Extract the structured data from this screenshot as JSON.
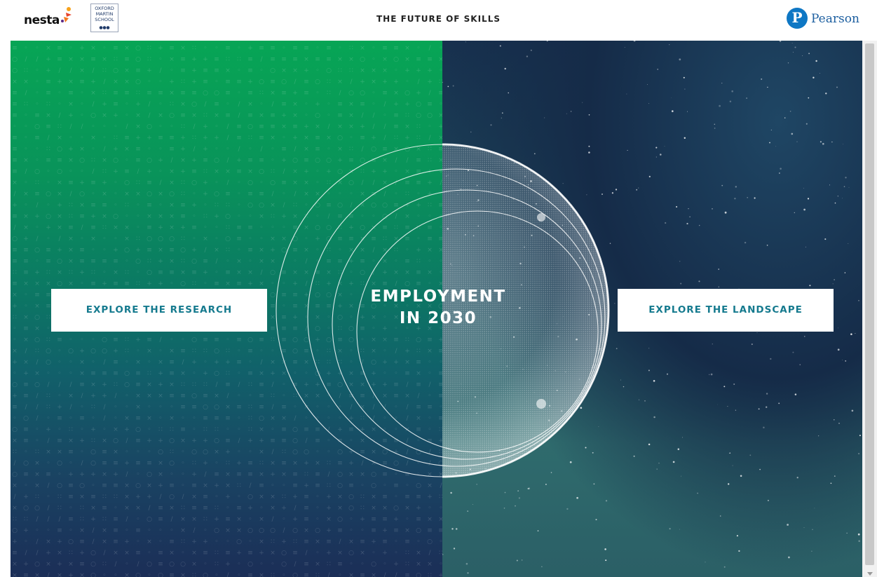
{
  "header": {
    "nesta_logo_text": "nesta",
    "oxford_logo_lines": [
      "OXFORD",
      "MARTIN",
      "SCHOOL"
    ],
    "page_title": "THE FUTURE OF SKILLS",
    "pearson_logo_text": "Pearson",
    "pearson_mark": "P"
  },
  "hero": {
    "title_line1": "EMPLOYMENT",
    "title_line2": "IN 2030",
    "left_button": "EXPLORE THE RESEARCH",
    "right_button": "EXPLORE THE LANDSCAPE"
  },
  "colors": {
    "left_top": "#07a555",
    "left_bottom": "#1b2e57",
    "right_top": "#17304e",
    "right_bottom": "#2b5f66",
    "button_text": "#157a8e",
    "pearson_blue": "#0e77c4"
  },
  "icons": [
    "nesta-mark-icon",
    "pearson-logo-icon",
    "sphere-graphic",
    "orbit-circles",
    "symbol-pattern",
    "starfield"
  ]
}
